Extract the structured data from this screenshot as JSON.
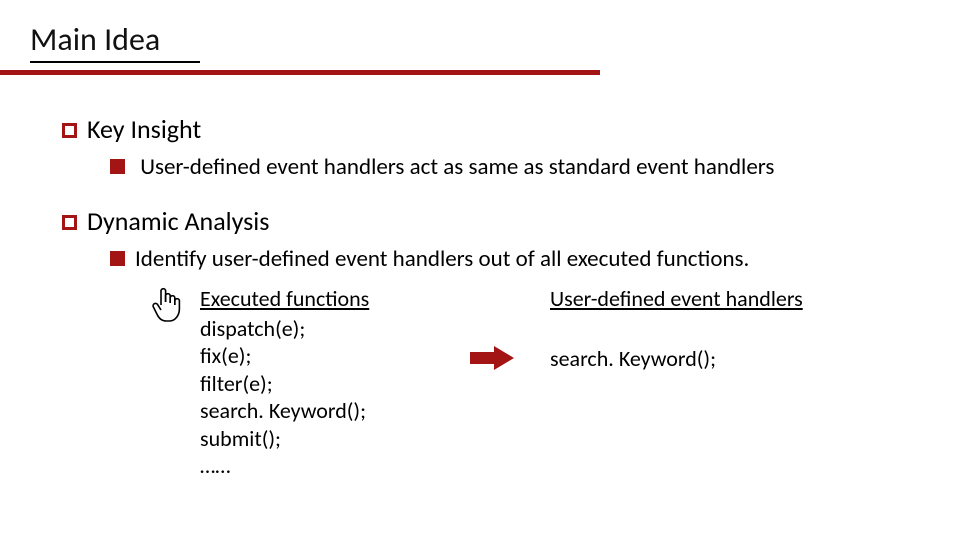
{
  "title": "Main Idea",
  "sections": [
    {
      "heading": "Key Insight",
      "points": [
        " User-defined event handlers act as same as standard event handlers"
      ]
    },
    {
      "heading": "Dynamic Analysis",
      "points": [
        "Identify user-defined event handlers out of all executed functions."
      ]
    }
  ],
  "executed": {
    "heading": "Executed functions",
    "lines": [
      "dispatch(e);",
      "fix(e);",
      "filter(e);",
      "search. Keyword();",
      "submit();",
      "……"
    ]
  },
  "userdef": {
    "heading": "User-defined event handlers",
    "lines": [
      "search. Keyword();"
    ]
  },
  "colors": {
    "accent": "#a31515"
  }
}
